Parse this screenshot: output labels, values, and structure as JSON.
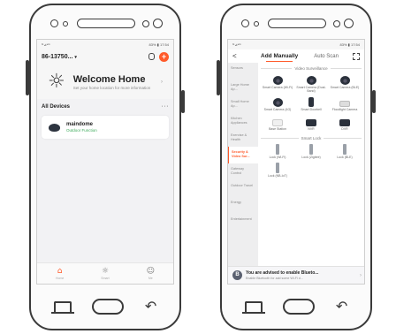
{
  "left": {
    "status": {
      "left": "ᵇᵗ⊿⁴ᴳ",
      "right": "83% ▮ 17:54"
    },
    "header": {
      "home_name": "86-13750...",
      "caret": "▾"
    },
    "welcome": {
      "title": "Welcome Home",
      "subtitle": "Set your home location for more information",
      "arrow": "›"
    },
    "devices": {
      "title": "All Devices",
      "more": "···"
    },
    "device": {
      "name": "maindome",
      "status": "Outdoor Function"
    },
    "tabs": [
      {
        "label": "Home"
      },
      {
        "label": "Smart"
      },
      {
        "label": "Me"
      }
    ]
  },
  "right": {
    "status": {
      "left": "ᵇᵗ⊿⁴ᴳ",
      "right": "83% ▮ 17:54"
    },
    "header": {
      "back": "<",
      "tab_manual": "Add Manually",
      "tab_auto": "Auto Scan"
    },
    "categories": [
      "Sensors",
      "Large Home Ap...",
      "Small Home Ap...",
      "Kitchen Appliances",
      "Exercise & Health",
      "Security & Video Sur...",
      "Gateway Control",
      "Outdoor Travel",
      "Energy",
      "Entertainment"
    ],
    "video_title": "Video Surveillance",
    "video_items": [
      {
        "label": "Smart Camera (Wi-Fi)",
        "icon": "dome"
      },
      {
        "label": "Smart Camera (Dual-Band)",
        "icon": "dome"
      },
      {
        "label": "Smart Camera (BLE)",
        "icon": "dome"
      },
      {
        "label": "Smart Camera (4G)",
        "icon": "dome"
      },
      {
        "label": "Smart Doorbell",
        "icon": "bullet"
      },
      {
        "label": "Floodlight Camera",
        "icon": "flood"
      },
      {
        "label": "Base Station",
        "icon": "hub"
      },
      {
        "label": "NVR",
        "icon": "nvr"
      },
      {
        "label": "DVR",
        "icon": "nvr"
      }
    ],
    "lock_title": "Smart Lock",
    "lock_items": [
      {
        "label": "Lock (Wi-Fi)",
        "icon": "lock"
      },
      {
        "label": "Lock (Zigbee)",
        "icon": "lock"
      },
      {
        "label": "Lock (BLE)",
        "icon": "lock"
      },
      {
        "label": "Lock (NB-IoT)",
        "icon": "lock"
      }
    ],
    "banner": {
      "title": "You are advised to enable Blueto...",
      "subtitle": "Enable Bluetooth for add some Wi-Fi d...",
      "arrow": "›"
    }
  },
  "colors": {
    "accent": "#ff5a2a",
    "online": "#3caa5a"
  }
}
